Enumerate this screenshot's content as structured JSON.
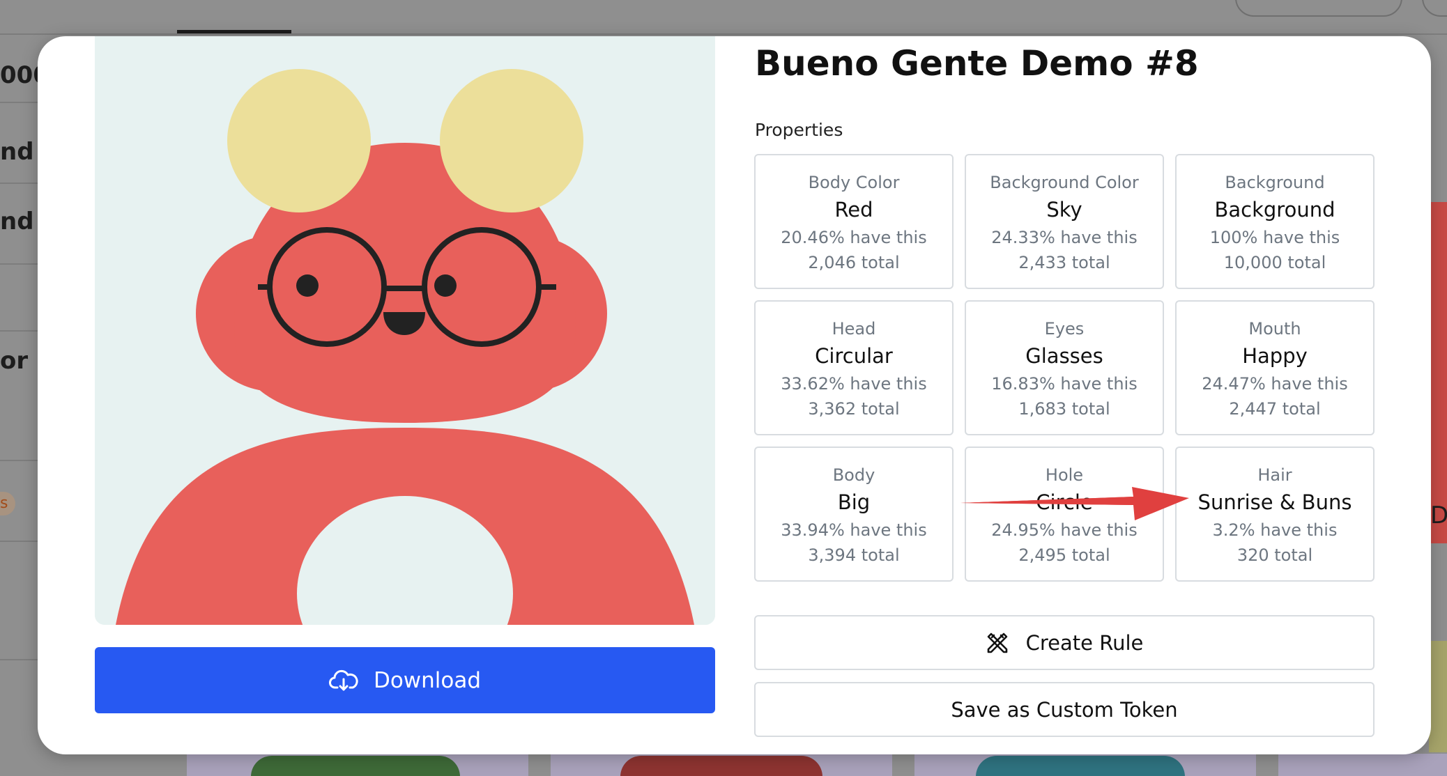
{
  "background_app": {
    "sidebar_fragments": [
      "000",
      "nd",
      "nd C",
      "or",
      "s"
    ],
    "right_fragment": "De"
  },
  "modal": {
    "title": "Bueno Gente Demo #8",
    "properties_label": "Properties",
    "properties": [
      {
        "category": "Body Color",
        "value": "Red",
        "percent": "20.46% have this",
        "total": "2,046 total"
      },
      {
        "category": "Background Color",
        "value": "Sky",
        "percent": "24.33% have this",
        "total": "2,433 total"
      },
      {
        "category": "Background",
        "value": "Background",
        "percent": "100% have this",
        "total": "10,000 total"
      },
      {
        "category": "Head",
        "value": "Circular",
        "percent": "33.62% have this",
        "total": "3,362 total"
      },
      {
        "category": "Eyes",
        "value": "Glasses",
        "percent": "16.83% have this",
        "total": "1,683 total"
      },
      {
        "category": "Mouth",
        "value": "Happy",
        "percent": "24.47% have this",
        "total": "2,447 total"
      },
      {
        "category": "Body",
        "value": "Big",
        "percent": "33.94% have this",
        "total": "3,394 total"
      },
      {
        "category": "Hole",
        "value": "Circle",
        "percent": "24.95% have this",
        "total": "2,495 total"
      },
      {
        "category": "Hair",
        "value": "Sunrise & Buns",
        "percent": "3.2% have this",
        "total": "320 total"
      }
    ],
    "download_label": "Download",
    "create_rule_label": "Create Rule",
    "save_token_label": "Save as Custom Token",
    "icons": {
      "download": "cloud-download-icon",
      "create_rule": "crossed-tools-icon"
    }
  },
  "colors": {
    "primary_button": "#2759f2",
    "annotation_arrow": "#e0403f",
    "body_color": "#e8605b",
    "hair_color": "#ecdf9a",
    "art_background": "#e7f2f1"
  }
}
